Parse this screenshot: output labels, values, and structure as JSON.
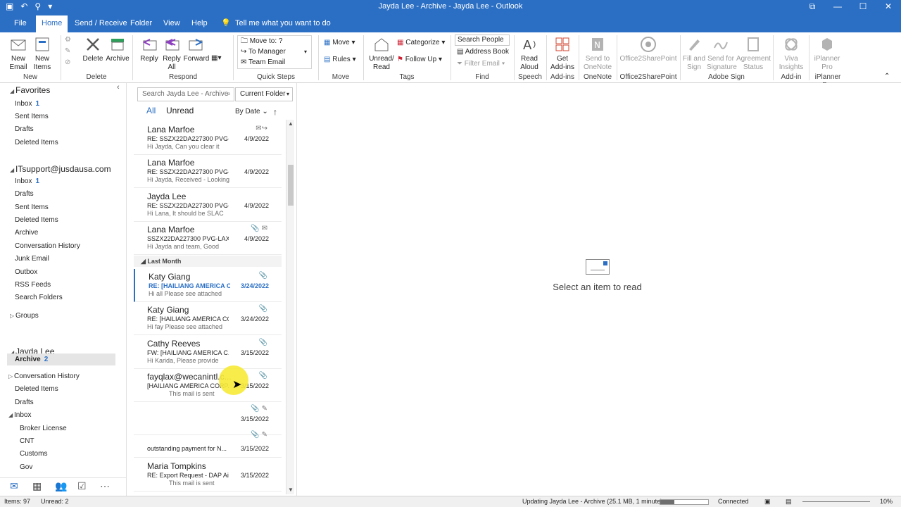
{
  "titlebar": {
    "title": "Jayda Lee - Archive - Jayda Lee  -  Outlook",
    "qat": [
      "▣",
      "↶",
      "⚲",
      "▾"
    ],
    "controls": [
      "⧉",
      "—",
      "☐",
      "✕"
    ]
  },
  "tabs": [
    "File",
    "Home",
    "Send / Receive",
    "Folder",
    "View",
    "Help"
  ],
  "tell_me": "Tell me what you want to do",
  "ribbon": {
    "new_email": "New Email",
    "new_items": "New Items",
    "new_group": "New",
    "delete": "Delete",
    "archive": "Archive",
    "delete_group": "Delete",
    "reply": "Reply",
    "reply_all": "Reply All",
    "forward": "Forward",
    "respond_group": "Respond",
    "qs_move_to": "Move to: ?",
    "qs_to_manager": "To Manager",
    "qs_team_email": "Team Email",
    "quicksteps_group": "Quick Steps",
    "move": "Move",
    "rules": "Rules",
    "move_group": "Move",
    "unread_read": "Unread/ Read",
    "categorize": "Categorize",
    "follow_up": "Follow Up",
    "tags_group": "Tags",
    "search_people": "Search People",
    "address_book": "Address Book",
    "filter_email": "Filter Email",
    "find_group": "Find",
    "read_aloud": "Read Aloud",
    "speech_group": "Speech",
    "get_addins": "Get Add-ins",
    "addins_group": "Add-ins",
    "send_onenote": "Send to OneNote",
    "onenote_group": "OneNote",
    "o2sp": "Office2SharePoint",
    "o2sp_group": "Office2SharePoint",
    "fill_sign": "Fill and Sign",
    "send_sig": "Send for Signature",
    "agreement": "Agreement Status",
    "adobe_group": "Adobe Sign",
    "viva": "Viva Insights",
    "addin_group": "Add-in",
    "iplanner": "iPlanner Pro",
    "iplanner_group": "iPlanner Pro"
  },
  "folders": {
    "favorites": "Favorites",
    "fav_items": [
      {
        "label": "Inbox",
        "count": "1"
      },
      {
        "label": "Sent Items",
        "count": ""
      },
      {
        "label": "Drafts",
        "count": ""
      },
      {
        "label": "Deleted Items",
        "count": ""
      }
    ],
    "account": "ITsupport@jusdausa.com",
    "acct_items": [
      {
        "label": "Inbox",
        "count": "1"
      },
      {
        "label": "Drafts",
        "count": ""
      },
      {
        "label": "Sent Items",
        "count": ""
      },
      {
        "label": "Deleted Items",
        "count": ""
      },
      {
        "label": "Archive",
        "count": ""
      },
      {
        "label": "Conversation History",
        "count": ""
      },
      {
        "label": "Junk Email",
        "count": ""
      },
      {
        "label": "Outbox",
        "count": ""
      },
      {
        "label": "RSS Feeds",
        "count": ""
      },
      {
        "label": "Search Folders",
        "count": ""
      }
    ],
    "groups": "Groups",
    "user": "Jayda Lee",
    "archive": "Archive",
    "archive_count": "2",
    "user_items": [
      "Conversation History",
      "Deleted Items",
      "Drafts",
      "Inbox"
    ],
    "inbox_sub": [
      "Broker License",
      "CNT",
      "Customs",
      "Gov"
    ]
  },
  "list": {
    "search_placeholder": "Search Jayda Lee - Archive",
    "scope": "Current Folder",
    "filter_all": "All",
    "filter_unread": "Unread",
    "sort": "By Date",
    "sort_dir": "↑",
    "group_last_month": "Last Month",
    "messages": [
      {
        "from": "Lana  Marfoe",
        "subject": "RE: SSZX22DA227300  PVG-...",
        "preview": "Hi Jayda,  Can you clear it",
        "date": "4/9/2022",
        "icons": "✉↪"
      },
      {
        "from": "Lana  Marfoe",
        "subject": "RE: SSZX22DA227300  PVG-...",
        "preview": "Hi Jayda,  Received - Looking",
        "date": "4/9/2022",
        "icons": ""
      },
      {
        "from": "Jayda Lee",
        "subject": "RE: SSZX22DA227300  PVG-...",
        "preview": "Hi Lana,  It should be SLAC",
        "date": "4/9/2022",
        "icons": ""
      },
      {
        "from": "Lana  Marfoe",
        "subject": "SSZX22DA227300  PVG-LAX ...",
        "preview": "Hi Jayda and team,  Good",
        "date": "4/9/2022",
        "icons": "📎 ✉"
      },
      {
        "from": "Katy Giang",
        "subject": "RE: [HAILIANG AMERICA C...",
        "preview": "Hi all  Please see attached",
        "date": "3/24/2022",
        "icons": "📎"
      },
      {
        "from": "Katy Giang",
        "subject": "RE: [HAILIANG AMERICA CO...",
        "preview": "Hi fay  Please see attached",
        "date": "3/24/2022",
        "icons": "📎"
      },
      {
        "from": "Cathy Reeves",
        "subject": "FW: [HAILIANG AMERICA C...",
        "preview": "Hi Karida,  Please provide",
        "date": "3/15/2022",
        "icons": "📎"
      },
      {
        "from": "fayqlax@wecanintl.c...",
        "subject": "[HAILIANG AMERICA CORP...",
        "preview": "This mail is sent",
        "date": "3/15/2022",
        "icons": "📎"
      },
      {
        "from": "",
        "subject": "",
        "preview": "",
        "date": "3/15/2022",
        "icons": "📎 ✎"
      },
      {
        "from": "",
        "subject": "outstanding payment for N...",
        "preview": "",
        "date": "3/15/2022",
        "icons": "📎 ✎"
      },
      {
        "from": "Maria Tompkins",
        "subject": "RE: Export Request - DAP Ai...",
        "preview": "This mail is sent",
        "date": "3/15/2022",
        "icons": ""
      }
    ]
  },
  "reading": {
    "message": "Select an item to read"
  },
  "status": {
    "items": "Items: 97",
    "unread": "Unread: 2",
    "updating": "Updating Jayda Lee - Archive (25.1 MB, 1 minute).",
    "progress": 0.3,
    "connected": "Connected",
    "zoom": "10%"
  },
  "colors": {
    "accent": "#2b6fc4"
  }
}
